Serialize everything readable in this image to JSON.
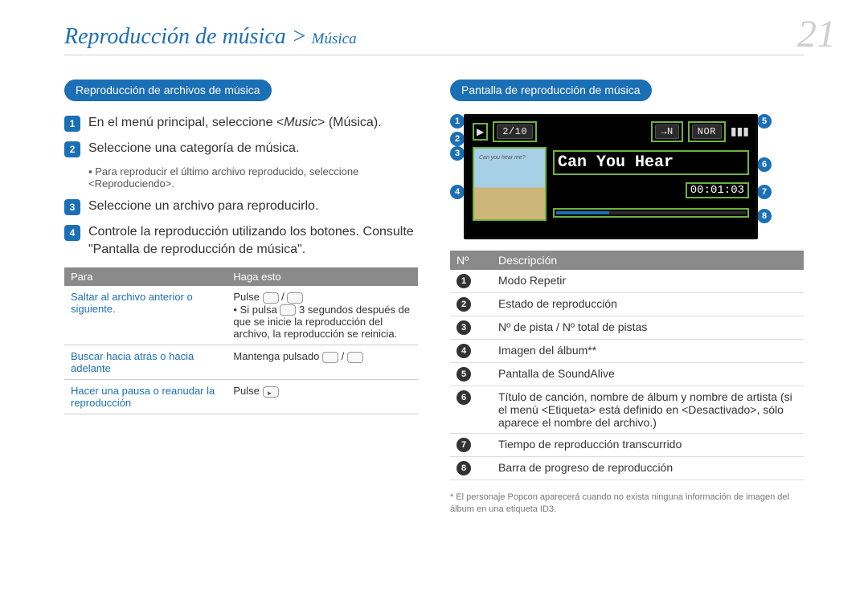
{
  "header": {
    "title": "Reproducción de música >",
    "sub": "Música"
  },
  "page_number": "21",
  "left": {
    "chip": "Reproducción de archivos de música",
    "steps": [
      {
        "n": "1",
        "html": "En el menú principal, seleccione <Music> (Música)."
      },
      {
        "n": "2",
        "html": "Seleccione una categoría de música."
      },
      {
        "n": "3",
        "html": "Seleccione un archivo para reproducirlo."
      },
      {
        "n": "4",
        "html": "Controle la reproducción utilizando los botones. Consulte \"Pantalla de reproducción de música\"."
      }
    ],
    "step2_note": "Para reproducir el último archivo reproducido, seleccione <Reproduciendo>.",
    "table": {
      "h1": "Para",
      "h2": "Haga esto",
      "rows": [
        {
          "para": "Saltar al archivo anterior o siguiente.",
          "do_line1": "Pulse ",
          "do_bullet": "Si pulsa      3 segundos después de que se inicie la reproducción del archivo, la reproducción se reinicia."
        },
        {
          "para": "Buscar hacia atrás o hacia adelante",
          "do_line1": "Mantenga pulsado "
        },
        {
          "para": "Hacer una pausa o reanudar la reproducción",
          "do_line1": "Pulse "
        }
      ]
    }
  },
  "right": {
    "chip": "Pantalla de reproducción de música",
    "screen": {
      "track_counter": "2/10",
      "repeat_glyph": "→N",
      "soundalive": "NOR",
      "song_title": "Can You Hear",
      "elapsed": "00:01:03",
      "album_caption": "Can you hear me?"
    },
    "table": {
      "h1": "Nº",
      "h2": "Descripción",
      "rows": [
        {
          "n": "1",
          "d": "Modo Repetir"
        },
        {
          "n": "2",
          "d": "Estado de reproducción"
        },
        {
          "n": "3",
          "d": "Nº de pista / Nº total de pistas"
        },
        {
          "n": "4",
          "d": "Imagen del álbum**"
        },
        {
          "n": "5",
          "d": "Pantalla de SoundAlive"
        },
        {
          "n": "6",
          "d": "Título de canción, nombre de álbum y nombre de artista (si el menú <Etiqueta> está definido en <Desactivado>, sólo aparece el nombre del archivo.)"
        },
        {
          "n": "7",
          "d": "Tiempo de reproducción transcurrido"
        },
        {
          "n": "8",
          "d": "Barra de progreso de reproducción"
        }
      ]
    },
    "footnote": "* El personaje Popcon aparecerá cuando no exista ninguna información de imagen del álbum en una etiqueta ID3."
  }
}
